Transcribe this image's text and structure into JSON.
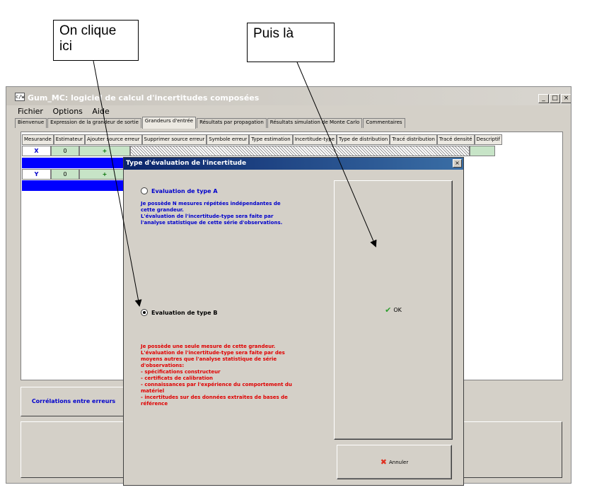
{
  "annotations": {
    "callout_1": "On clique ici",
    "callout_2": "Puis là"
  },
  "window": {
    "title": "Gum_MC: logiciel de calcul d'incertitudes composées",
    "app_icon_label": "c/w",
    "min_label": "_",
    "max_label": "□",
    "close_label": "×"
  },
  "menu": [
    "Fichier",
    "Options",
    "Aide"
  ],
  "tabs": [
    {
      "label": "Bienvenue",
      "active": false
    },
    {
      "label": "Expression de la grandeur de sortie",
      "active": false
    },
    {
      "label": "Grandeurs d'entrée",
      "active": true
    },
    {
      "label": "Résultats par propagation",
      "active": false
    },
    {
      "label": "Résultats simulation de Monte Carlo",
      "active": false
    },
    {
      "label": "Commentaires",
      "active": false
    }
  ],
  "grid": {
    "headers": [
      "Mesurande",
      "Estimateur",
      "Ajouter source erreur",
      "Supprimer source erreur",
      "Symbole erreur",
      "Type estimation",
      "Incertitude-type",
      "Type de distribution",
      "Tracé distribution",
      "Tracé densité",
      "Descriptif"
    ],
    "rows": [
      {
        "name": "X",
        "estimator": "0",
        "add": "+"
      },
      {
        "name": "Y",
        "estimator": "0",
        "add": "+"
      }
    ]
  },
  "correlations_label": "Corrélations entre erreurs",
  "dialog": {
    "title": "Type d'évaluation de l'incertitude",
    "close_label": "×",
    "type_a_label": "Evaluation de type A",
    "type_a_desc": "Je possède N mesures répétées indépendantes de cette grandeur.\nL'évaluation de l'incertitude-type sera faite par l'analyse statistique de cette série d'observations.",
    "type_b_label": "Evaluation de type B",
    "type_b_desc": "Je possède une seule mesure de cette grandeur.\nL'évaluation de l'incertitude-type sera faite par des moyens autres que l'analyse statistique de série d'observations:\n- spécifications constructeur\n- certificats de calibration\n- connaissances par l'expérience du comportement du matériel\n- incertitudes sur des données extraites de bases de référence",
    "selected": "B",
    "ok_label": "OK",
    "cancel_label": "Annuler"
  }
}
